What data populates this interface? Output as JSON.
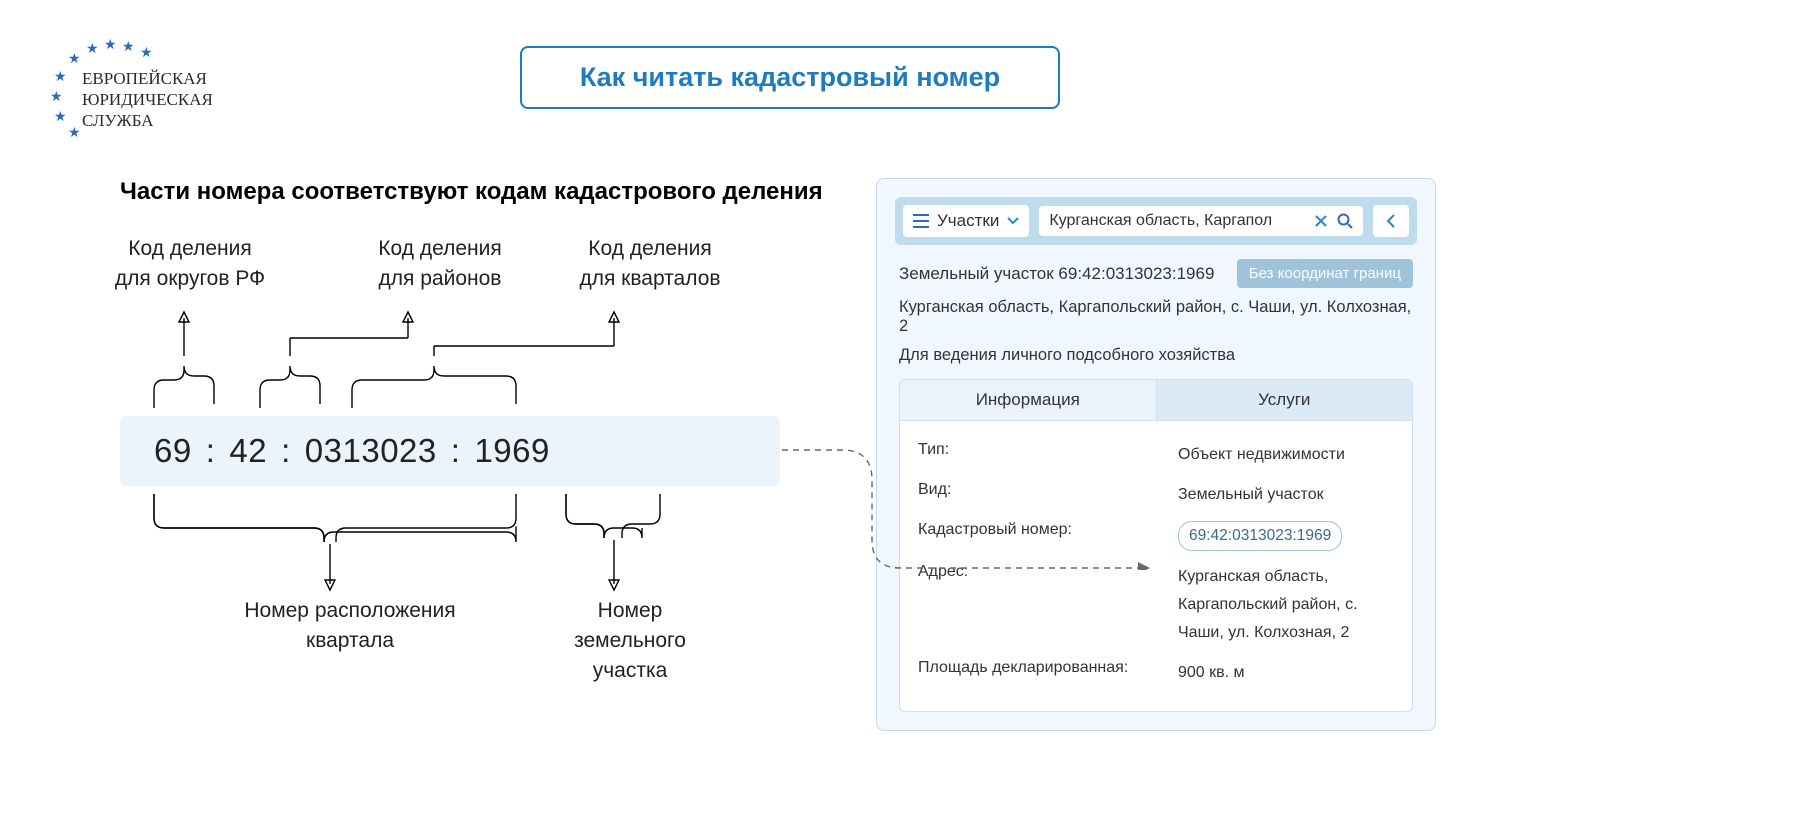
{
  "logo": {
    "line1": "ЕВРОПЕЙСКАЯ",
    "line2": "ЮРИДИЧЕСКАЯ",
    "line3": "СЛУЖБА"
  },
  "title": "Как читать кадастровый номер",
  "diagram": {
    "heading": "Части номера соответствуют кодам кадастрового деления",
    "top_labels": {
      "districts": {
        "l1": "Код деления",
        "l2": "для округов РФ"
      },
      "regions": {
        "l1": "Код деления",
        "l2": "для районов"
      },
      "quarters": {
        "l1": "Код деления",
        "l2": "для кварталов"
      }
    },
    "segments": {
      "s1": "69",
      "c1": ":",
      "s2": "42",
      "c2": ":",
      "s3": "0313023",
      "c3": ":",
      "s4": "1969"
    },
    "bottom_labels": {
      "quarter_pos": {
        "l1": "Номер расположения",
        "l2": "квартала"
      },
      "parcel": {
        "l1": "Номер",
        "l2": "земельного",
        "l3": "участка"
      }
    }
  },
  "card": {
    "search": {
      "category": "Участки",
      "query": "Курганская область, Каргапол"
    },
    "object_title": "Земельный участок 69:42:0313023:1969",
    "badge": "Без координат границ",
    "address": "Курганская область, Каргапольский район, с. Чаши, ул. Колхозная, 2",
    "purpose": "Для ведения личного подсобного хозяйства",
    "tabs": {
      "info": "Информация",
      "services": "Услуги"
    },
    "info": {
      "type_label": "Тип:",
      "type_value": "Объект недвижимости",
      "kind_label": "Вид:",
      "kind_value": "Земельный участок",
      "cad_label": "Кадастровый номер:",
      "cad_value": "69:42:0313023:1969",
      "addr_label": "Адрес:",
      "addr_value": "Курганская область, Каргапольский район, с. Чаши, ул. Колхозная, 2",
      "area_label": "Площадь декларированная:",
      "area_value": "900 кв. м"
    }
  }
}
